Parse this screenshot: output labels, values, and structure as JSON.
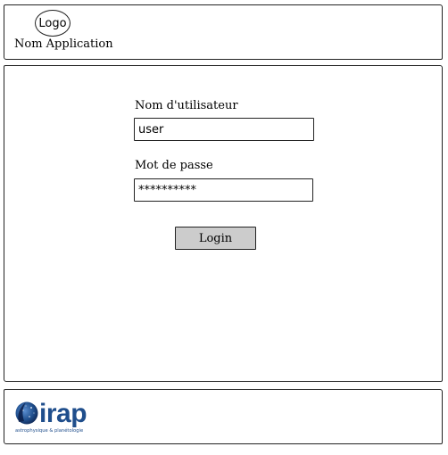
{
  "header": {
    "logo_text": "Logo",
    "app_name": "Nom Application"
  },
  "login_form": {
    "username_label": "Nom d'utilisateur",
    "username_value": "user",
    "password_label": "Mot de passe",
    "password_value": "**********",
    "login_label": "Login"
  },
  "footer": {
    "brand_logo": {
      "wordmark": "irap",
      "tagline": "astrophysique & planétologie",
      "colors": {
        "primary_blue": "#1f4e8c",
        "deep_blue": "#0b1f4a",
        "light_blue": "#5b8fd1"
      }
    }
  }
}
